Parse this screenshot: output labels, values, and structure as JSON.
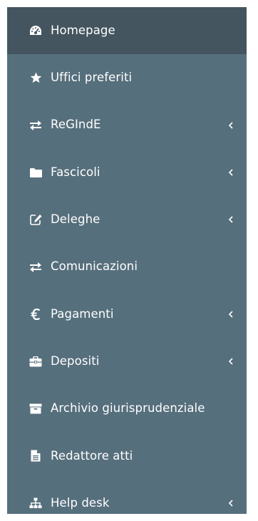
{
  "sidebar": {
    "colors": {
      "background": "#566f7c",
      "active_background": "#44555f",
      "text": "#ffffff"
    },
    "items": [
      {
        "label": "Homepage",
        "icon": "dashboard-icon",
        "active": true,
        "has_submenu": false
      },
      {
        "label": "Uffici preferiti",
        "icon": "star-icon",
        "active": false,
        "has_submenu": false
      },
      {
        "label": "ReGIndE",
        "icon": "exchange-icon",
        "active": false,
        "has_submenu": true
      },
      {
        "label": "Fascicoli",
        "icon": "folder-icon",
        "active": false,
        "has_submenu": true
      },
      {
        "label": "Deleghe",
        "icon": "edit-icon",
        "active": false,
        "has_submenu": true
      },
      {
        "label": "Comunicazioni",
        "icon": "exchange-icon",
        "active": false,
        "has_submenu": false
      },
      {
        "label": "Pagamenti",
        "icon": "euro-icon",
        "active": false,
        "has_submenu": true
      },
      {
        "label": "Depositi",
        "icon": "briefcase-icon",
        "active": false,
        "has_submenu": true
      },
      {
        "label": "Archivio giurisprudenziale",
        "icon": "archive-icon",
        "active": false,
        "has_submenu": false
      },
      {
        "label": "Redattore atti",
        "icon": "file-text-icon",
        "active": false,
        "has_submenu": false
      },
      {
        "label": "Help desk",
        "icon": "sitemap-icon",
        "active": false,
        "has_submenu": true
      }
    ]
  }
}
